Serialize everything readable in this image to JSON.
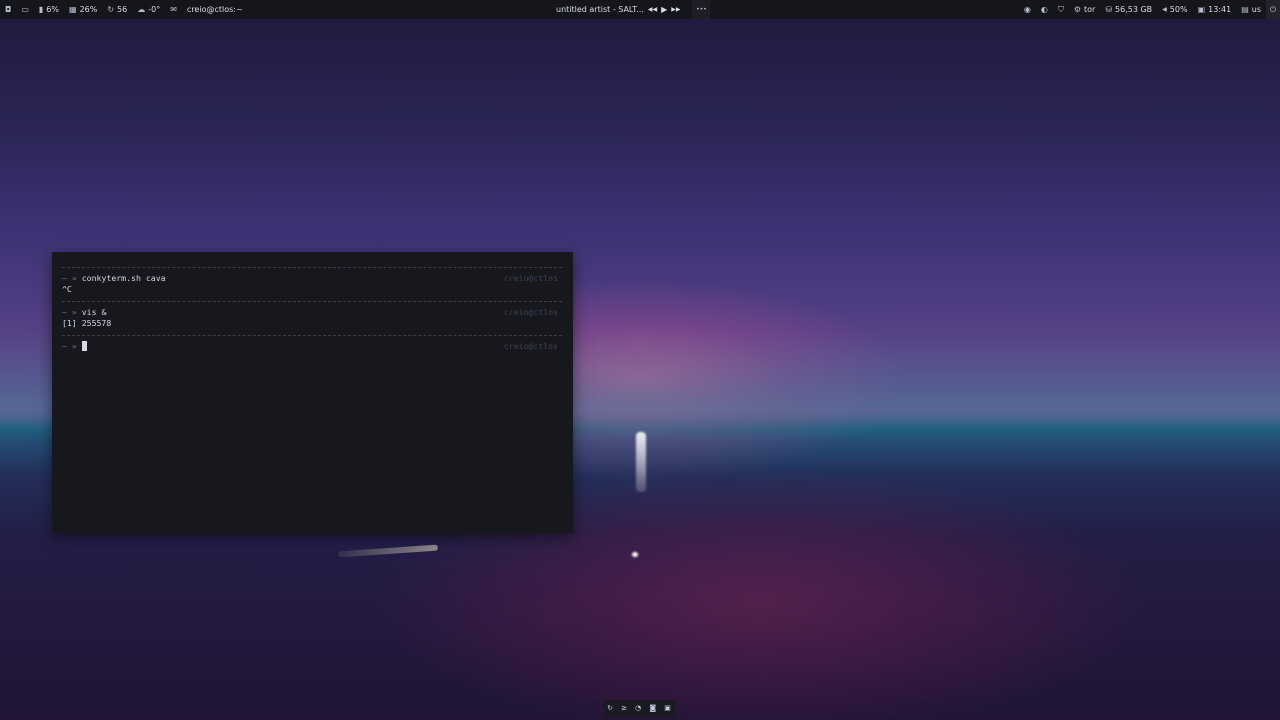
{
  "topbar": {
    "left": [
      {
        "icon": "shield-icon",
        "glyph": "◘",
        "text": ""
      },
      {
        "icon": "monitor-icon",
        "glyph": "▭",
        "text": ""
      },
      {
        "icon": "cpu-icon",
        "glyph": "▮",
        "text": "6%"
      },
      {
        "icon": "memory-icon",
        "glyph": "▦",
        "text": "26%"
      },
      {
        "icon": "updates-icon",
        "glyph": "↻",
        "text": "56"
      },
      {
        "icon": "weather-icon",
        "glyph": "☁",
        "text": "-0°"
      },
      {
        "icon": "mail-icon",
        "glyph": "✉",
        "text": ""
      },
      {
        "icon": "",
        "glyph": "",
        "text": "creio@ctlos:~"
      }
    ],
    "media": {
      "title": "untitled artist - SALT...",
      "prev_glyph": "◀◀",
      "play_glyph": "▶",
      "next_glyph": "▶▶",
      "menu_glyph": "•••"
    },
    "right": [
      {
        "icon": "eye-icon",
        "glyph": "◉",
        "text": ""
      },
      {
        "icon": "contrast-icon",
        "glyph": "◐",
        "text": ""
      },
      {
        "icon": "vpn-shield-icon",
        "glyph": "⛉",
        "text": ""
      },
      {
        "icon": "tor-icon",
        "glyph": "⚙",
        "text": "tor"
      },
      {
        "icon": "disk-icon",
        "glyph": "⛁",
        "text": "56,53 GB"
      },
      {
        "icon": "volume-icon",
        "glyph": "◀",
        "text": "50%"
      },
      {
        "icon": "calendar-icon",
        "glyph": "▣",
        "text": "13:41"
      },
      {
        "icon": "keyboard-icon",
        "glyph": "▤",
        "text": "us"
      },
      {
        "icon": "power-icon",
        "glyph": "⏻",
        "text": ""
      }
    ]
  },
  "terminal": {
    "host": "creio@ctlos",
    "prompt_tilde": "~",
    "prompt_arrow": "»",
    "blocks": [
      {
        "command": "conkyterm.sh cava",
        "output": "^C"
      },
      {
        "command": "vis &",
        "output": "[1] 255578"
      },
      {
        "command": "",
        "output": ""
      }
    ]
  },
  "dock": {
    "items": [
      {
        "icon": "refresh-icon",
        "glyph": "↻"
      },
      {
        "icon": "terminal-icon",
        "glyph": "≥"
      },
      {
        "icon": "rss-icon",
        "glyph": "◔"
      },
      {
        "icon": "discord-icon",
        "glyph": "◙"
      },
      {
        "icon": "screenshot-icon",
        "glyph": "▣"
      }
    ]
  }
}
